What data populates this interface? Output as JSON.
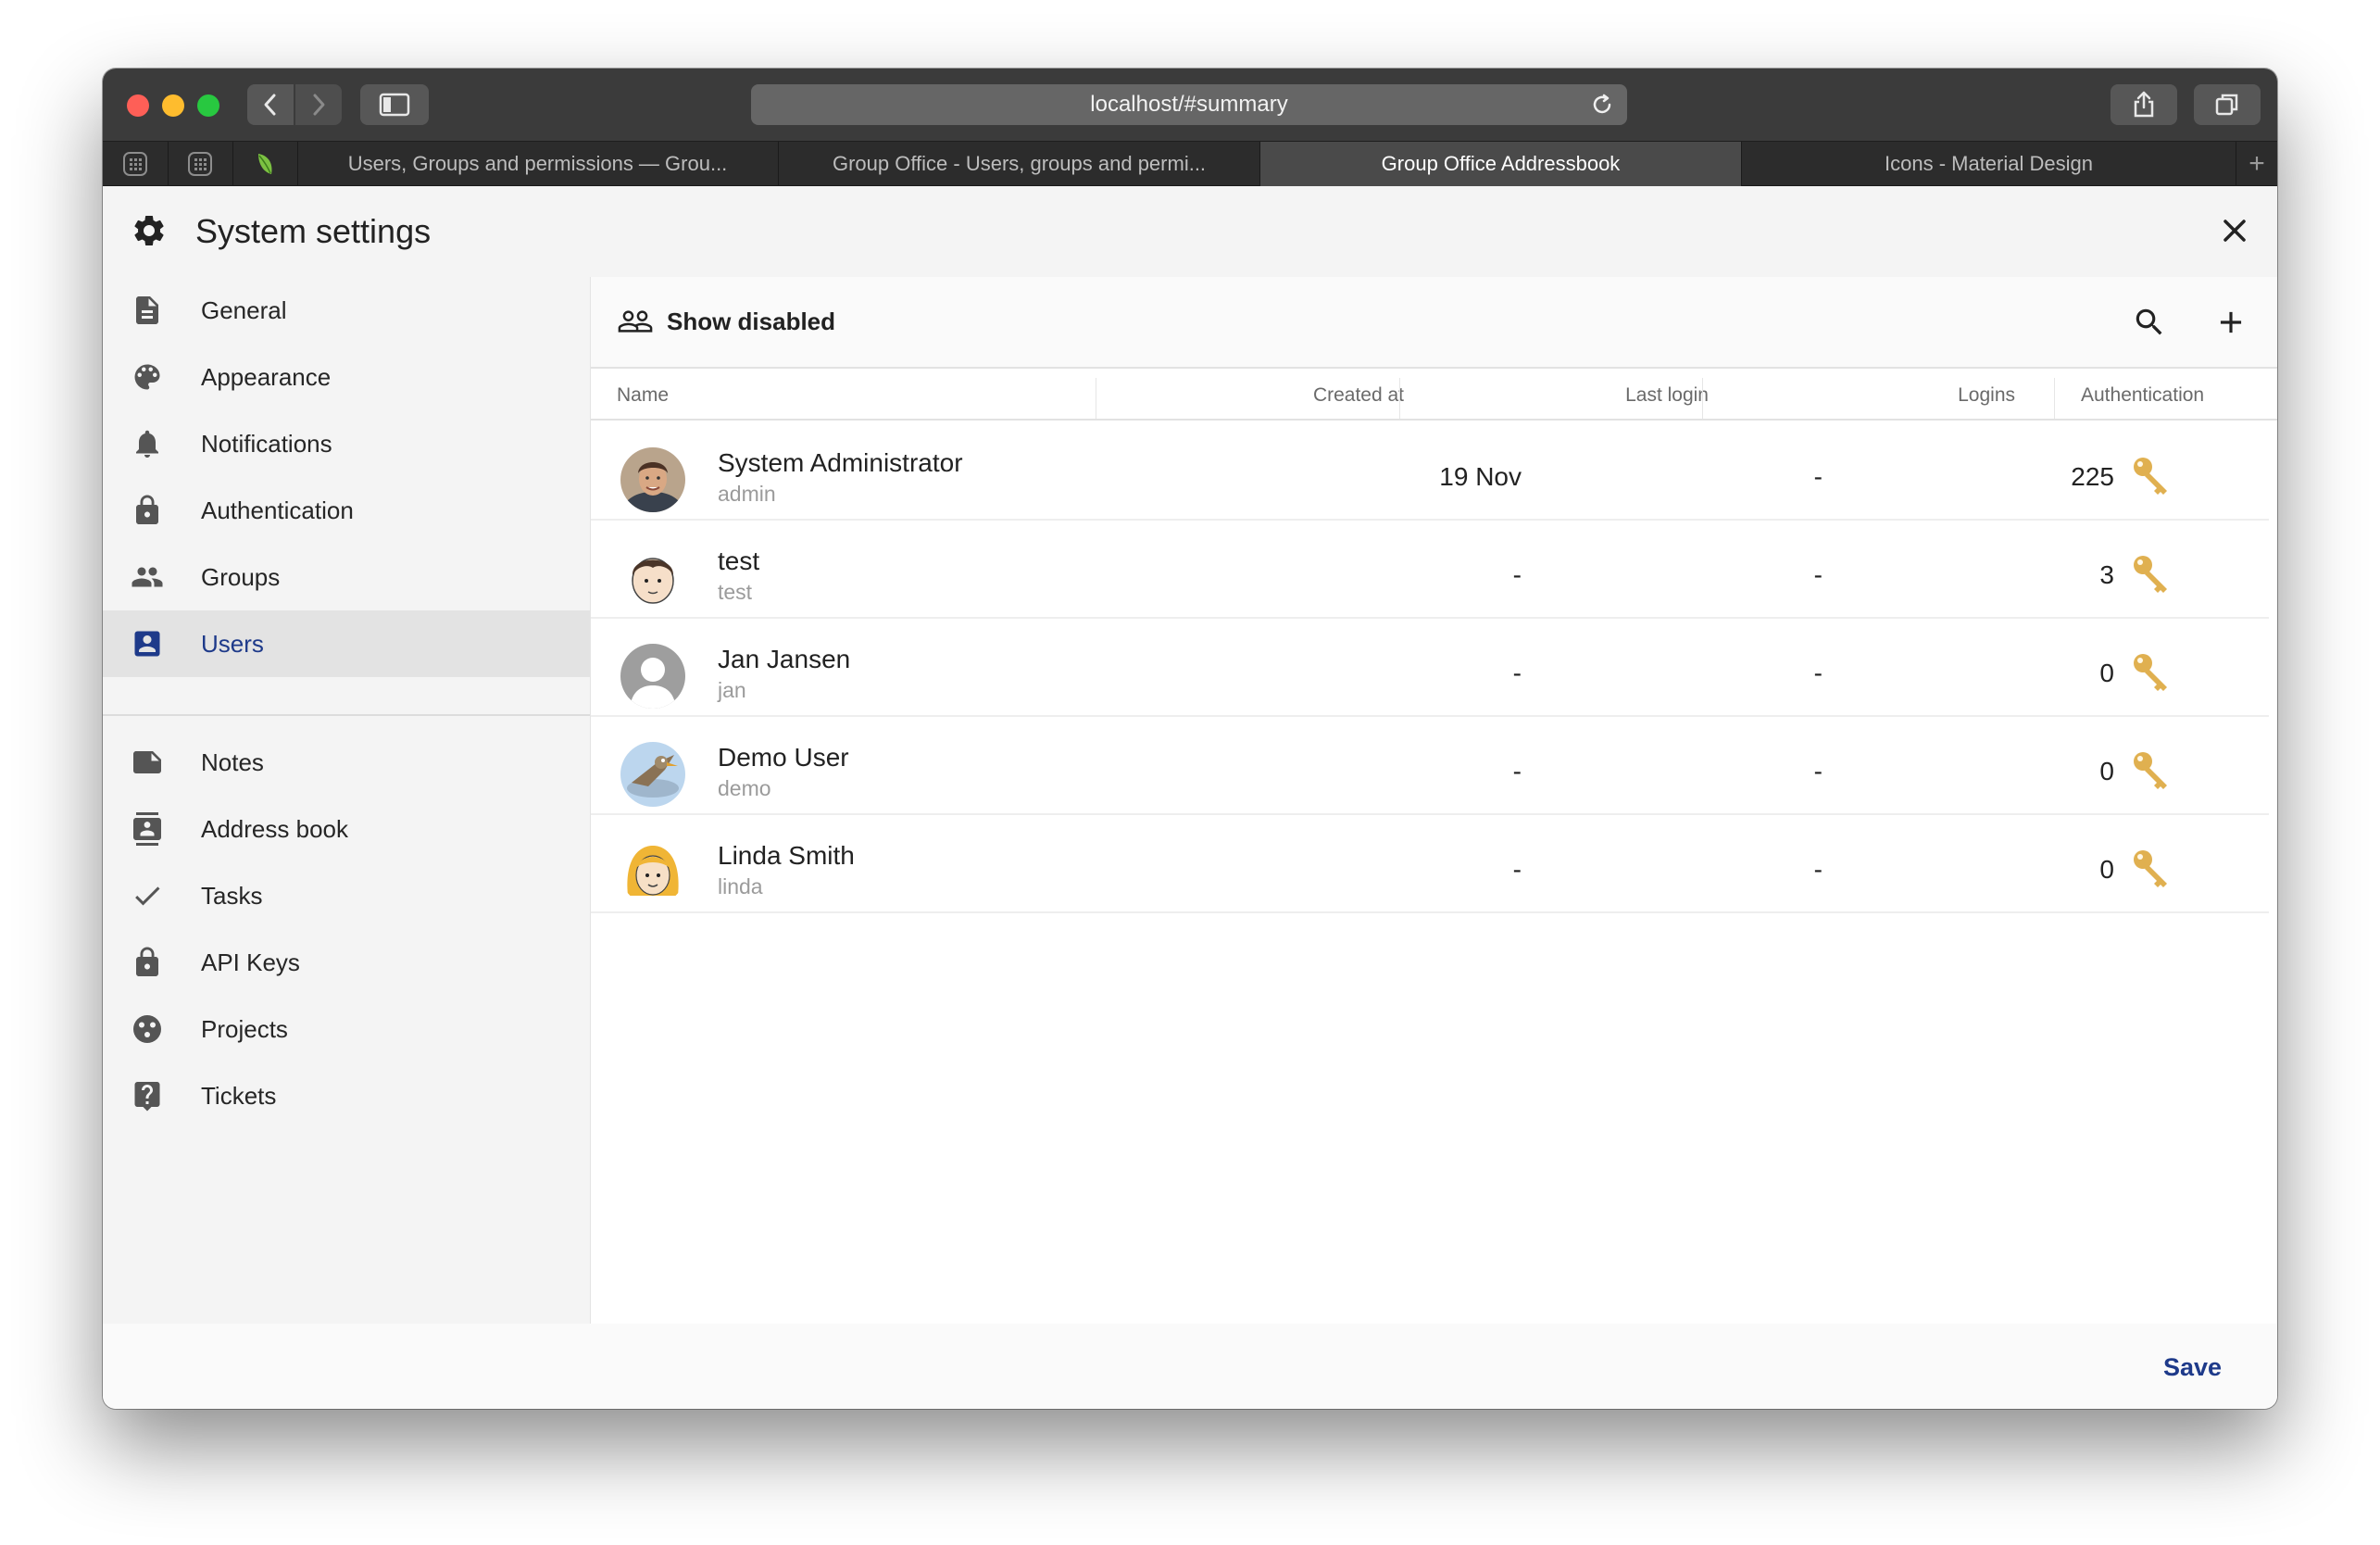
{
  "browser": {
    "url": "localhost/#summary",
    "tabs": [
      {
        "label": "Users, Groups and permissions — Grou...",
        "active": false
      },
      {
        "label": "Group Office - Users, groups and permi...",
        "active": false
      },
      {
        "label": "Group Office Addressbook",
        "active": true
      },
      {
        "label": "Icons - Material Design",
        "active": false
      }
    ],
    "new_tab_label": "+"
  },
  "dialog": {
    "title": "System settings",
    "save_label": "Save"
  },
  "sidebar": {
    "items": [
      {
        "label": "General",
        "icon": "document-icon",
        "active": false
      },
      {
        "label": "Appearance",
        "icon": "palette-icon",
        "active": false
      },
      {
        "label": "Notifications",
        "icon": "bell-icon",
        "active": false
      },
      {
        "label": "Authentication",
        "icon": "lock-icon",
        "active": false
      },
      {
        "label": "Groups",
        "icon": "people-icon",
        "active": false
      },
      {
        "label": "Users",
        "icon": "account-box-icon",
        "active": true
      }
    ],
    "modules": [
      {
        "label": "Notes",
        "icon": "note-icon"
      },
      {
        "label": "Address book",
        "icon": "contacts-icon"
      },
      {
        "label": "Tasks",
        "icon": "check-icon"
      },
      {
        "label": "API Keys",
        "icon": "lock-icon"
      },
      {
        "label": "Projects",
        "icon": "projects-icon"
      },
      {
        "label": "Tickets",
        "icon": "help-box-icon"
      }
    ]
  },
  "toolbar": {
    "show_disabled_label": "Show disabled"
  },
  "table": {
    "columns": [
      "Name",
      "Created at",
      "Last login",
      "Logins",
      "Authentication"
    ],
    "rows": [
      {
        "name": "System Administrator",
        "username": "admin",
        "created": "19 Nov",
        "last_login": "-",
        "logins": "225",
        "avatar": "photo-man"
      },
      {
        "name": "test",
        "username": "test",
        "created": "-",
        "last_login": "-",
        "logins": "3",
        "avatar": "cartoon-boy"
      },
      {
        "name": "Jan Jansen",
        "username": "jan",
        "created": "-",
        "last_login": "-",
        "logins": "0",
        "avatar": "default-person"
      },
      {
        "name": "Demo User",
        "username": "demo",
        "created": "-",
        "last_login": "-",
        "logins": "0",
        "avatar": "cartoon-bird"
      },
      {
        "name": "Linda Smith",
        "username": "linda",
        "created": "-",
        "last_login": "-",
        "logins": "0",
        "avatar": "cartoon-girl"
      }
    ]
  },
  "colors": {
    "accent": "#1e3a8a",
    "key": "#e0b050",
    "selected_bg": "#e3e3e3"
  }
}
